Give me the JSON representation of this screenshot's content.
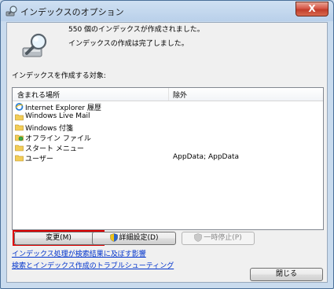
{
  "window": {
    "title": "インデックスのオプション",
    "close_label": "X"
  },
  "status": {
    "count_text": "550 個のインデックスが作成されました。",
    "complete_text": "インデックスの作成は完了しました。"
  },
  "locations": {
    "section_label": "インデックスを作成する対象:",
    "columns": {
      "included": "含まれる場所",
      "excluded": "除外"
    },
    "rows": [
      {
        "name": "Internet Explorer 履歴",
        "excluded": "",
        "icon": "ie-history-icon"
      },
      {
        "name": "Windows Live Mail",
        "excluded": "",
        "icon": "folder-icon"
      },
      {
        "name": "Windows 付箋",
        "excluded": "",
        "icon": "folder-icon"
      },
      {
        "name": "オフライン ファイル",
        "excluded": "",
        "icon": "offline-files-icon"
      },
      {
        "name": "スタート メニュー",
        "excluded": "",
        "icon": "folder-icon"
      },
      {
        "name": "ユーザー",
        "excluded": "AppData; AppData",
        "icon": "folder-icon"
      }
    ]
  },
  "buttons": {
    "modify": "変更(M)",
    "advanced": "詳細設定(D)",
    "pause": "一時停止(P)",
    "close": "閉じる"
  },
  "links": {
    "affect_results": "インデックス処理が検索結果に及ぼす影響",
    "troubleshoot": "検索とインデックス作成のトラブルシューティング"
  },
  "colors": {
    "highlight": "#e00000",
    "link": "#0033cc"
  }
}
